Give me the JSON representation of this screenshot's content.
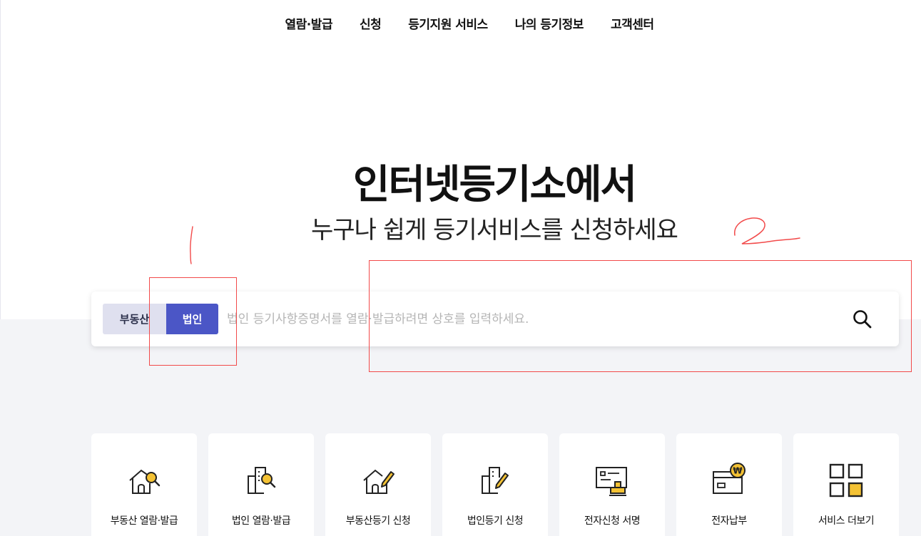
{
  "nav": {
    "items": [
      "열람·발급",
      "신청",
      "등기지원 서비스",
      "나의 등기정보",
      "고객센터"
    ]
  },
  "hero": {
    "title": "인터넷등기소에서",
    "subtitle": "누구나 쉽게 등기서비스를 신청하세요"
  },
  "search": {
    "tabs": [
      "부동산",
      "법인"
    ],
    "active_tab": "법인",
    "placeholder": "법인 등기사항증명서를 열람·발급하려면 상호를 입력하세요.",
    "value": ""
  },
  "annotations": {
    "label_1": "1",
    "label_2": "2",
    "color": "#f24a4a"
  },
  "services": [
    {
      "label": "부동산 열람·발급",
      "icon": "house-search-icon"
    },
    {
      "label": "법인 열람·발급",
      "icon": "building-search-icon"
    },
    {
      "label": "부동산등기 신청",
      "icon": "house-pen-icon"
    },
    {
      "label": "법인등기 신청",
      "icon": "building-pen-icon"
    },
    {
      "label": "전자신청 서명",
      "icon": "document-stamp-icon"
    },
    {
      "label": "전자납부",
      "icon": "card-won-icon"
    },
    {
      "label": "서비스 더보기",
      "icon": "grid-icon"
    }
  ],
  "colors": {
    "accent": "#4b56c6",
    "tab_inactive": "#dfe0ef",
    "icon_yellow": "#f4c234",
    "background_gray": "#f3f4f7"
  }
}
